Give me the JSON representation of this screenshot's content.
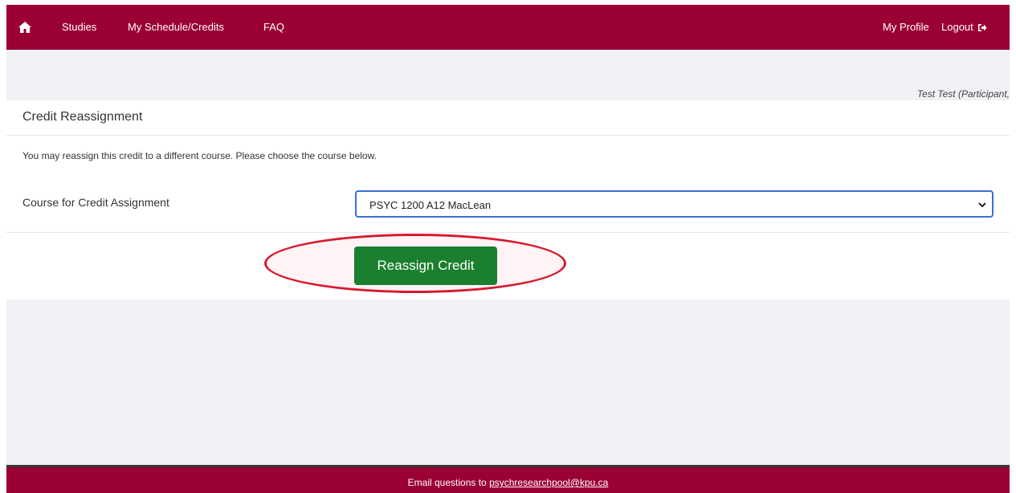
{
  "navbar": {
    "home_icon": "home-icon",
    "items": [
      {
        "label": "Studies"
      },
      {
        "label": "My Schedule/Credits"
      },
      {
        "label": "FAQ"
      }
    ],
    "profile_label": "My Profile",
    "logout_label": "Logout",
    "logout_icon": "logout-icon",
    "background": "#9a0036"
  },
  "user": {
    "display": "Test Test (Participant,"
  },
  "card": {
    "title": "Credit Reassignment",
    "instructions": "You may reassign this credit to a different course. Please choose the course below.",
    "field_label": "Course for Credit Assignment",
    "selected_course": "PSYC 1200 A12 MacLean",
    "button_label": "Reassign Credit",
    "button_color": "#1a7f2e",
    "highlight_color": "#d7192f"
  },
  "footer": {
    "prefix": "Email questions to ",
    "email": "psychresearchpool@kpu.ca"
  }
}
